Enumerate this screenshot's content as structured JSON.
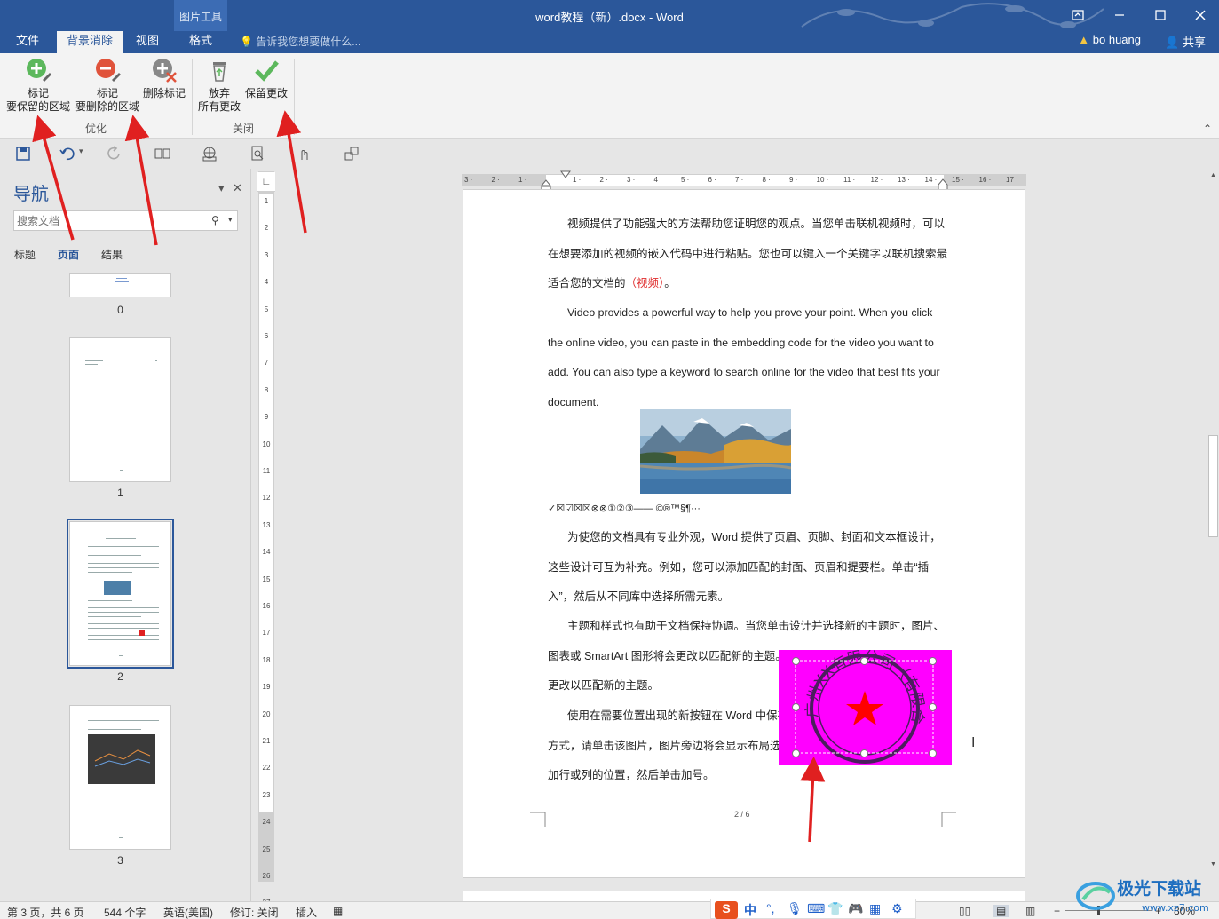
{
  "window": {
    "title": "word教程（新）.docx - Word",
    "context_group": "图片工具",
    "user": "bo huang",
    "share": "共享",
    "tell_me": "告诉我您想要做什么..."
  },
  "tabs": {
    "file": "文件",
    "background_removal": "背景消除",
    "view": "视图",
    "format": "格式"
  },
  "ribbon": {
    "mark_keep": [
      "标记",
      "要保留的区域"
    ],
    "mark_remove": [
      "标记",
      "要删除的区域"
    ],
    "delete_mark": "删除标记",
    "discard": [
      "放弃",
      "所有更改"
    ],
    "keep_changes": "保留更改",
    "group_refine": "优化",
    "group_close": "关闭"
  },
  "nav": {
    "title": "导航",
    "search_placeholder": "搜索文档",
    "tabs": [
      "标题",
      "页面",
      "结果"
    ],
    "page_labels": [
      "0",
      "1",
      "2",
      "3"
    ]
  },
  "document": {
    "paragraphs": [
      "视频提供了功能强大的方法帮助您证明您的观点。当您单击联机视频时，可以在想要添加的视频的嵌入代码中进行粘贴。您也可以键入一个关键字以联机搜索最适合您的文档的",
      "（视频）",
      "。",
      "Video provides a powerful way to help you prove your point. When you click the online video, you can paste in the embedding code for the video you want to add. You can also type a keyword to search online for the video that best fits your document.",
      "为使您的文档具有专业外观，Word  提供了页眉、页脚、封面和文本框设计，这些设计可互为补充。例如，您可以添加匹配的封面、页眉和提要栏。单击“插入”，然后从不同库中选择所需元素。",
      "主题和样式也有助于文档保持协调。当您单击设计并选择新的主题时，图片、图表或  SmartArt  图形将会更改以匹配新的主题。当应用样式时，您的标题会进行更改以匹配新的主题。",
      "使用在需要位置出现的新按钮在  Word  中保存时间。若要更改图片适应文档的方式，请单击该图片，图片旁边将会显示布局选项按钮。当处理表格时，单击要添加行或列的位置，然后单击加号。"
    ],
    "symbols_line": "✓☒☑☒☒⊗⊗①②③——    ©®™§¶···",
    "page_footer": "2 / 6",
    "stamp_text": "广州XX有限公司（有限合伙）"
  },
  "status": {
    "page": "第 3 页，共 6 页",
    "words": "544 个字",
    "language": "英语(美国)",
    "revision": "修订: 关闭",
    "insert": "插入",
    "zoom": "80%"
  },
  "ime": {
    "chinese": "中"
  },
  "watermark": {
    "brand": "极光下载站",
    "url": "www.xz7.com"
  },
  "colors": {
    "title_bar": "#2b579a",
    "stamp_background": "#ff00ff",
    "stamp_ink": "#ff0000",
    "annotation_arrow": "#e02020"
  }
}
